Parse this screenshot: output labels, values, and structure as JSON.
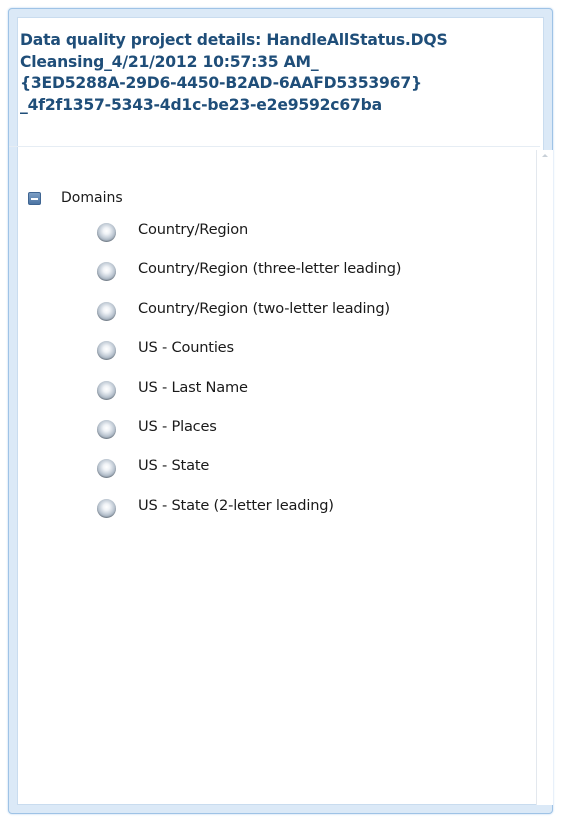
{
  "panel": {
    "title_lines": [
      "Data quality project details: HandleAllStatus.DQS",
      "Cleansing_4/21/2012 10:57:35 AM_",
      "{3ED5288A-29D6-4450-B2AD-6AAFD5353967}",
      "_4f2f1357-5343-4d1c-be23-e2e9592c67ba"
    ]
  },
  "tree": {
    "root_label": "Domains",
    "root_state_icon": "collapse-minus-icon",
    "item_icon": "sphere-bullet-icon",
    "items": [
      {
        "label": "Country/Region"
      },
      {
        "label": "Country/Region (three-letter leading)"
      },
      {
        "label": "Country/Region (two-letter leading)"
      },
      {
        "label": "US - Counties"
      },
      {
        "label": "US - Last Name"
      },
      {
        "label": "US - Places"
      },
      {
        "label": "US - State"
      },
      {
        "label": "US - State (2-letter leading)"
      }
    ]
  },
  "colors": {
    "title": "#1f4e79",
    "frame": "#9ec3e6",
    "frame_fill": "#dbe9f7",
    "text": "#1a1a1a"
  }
}
